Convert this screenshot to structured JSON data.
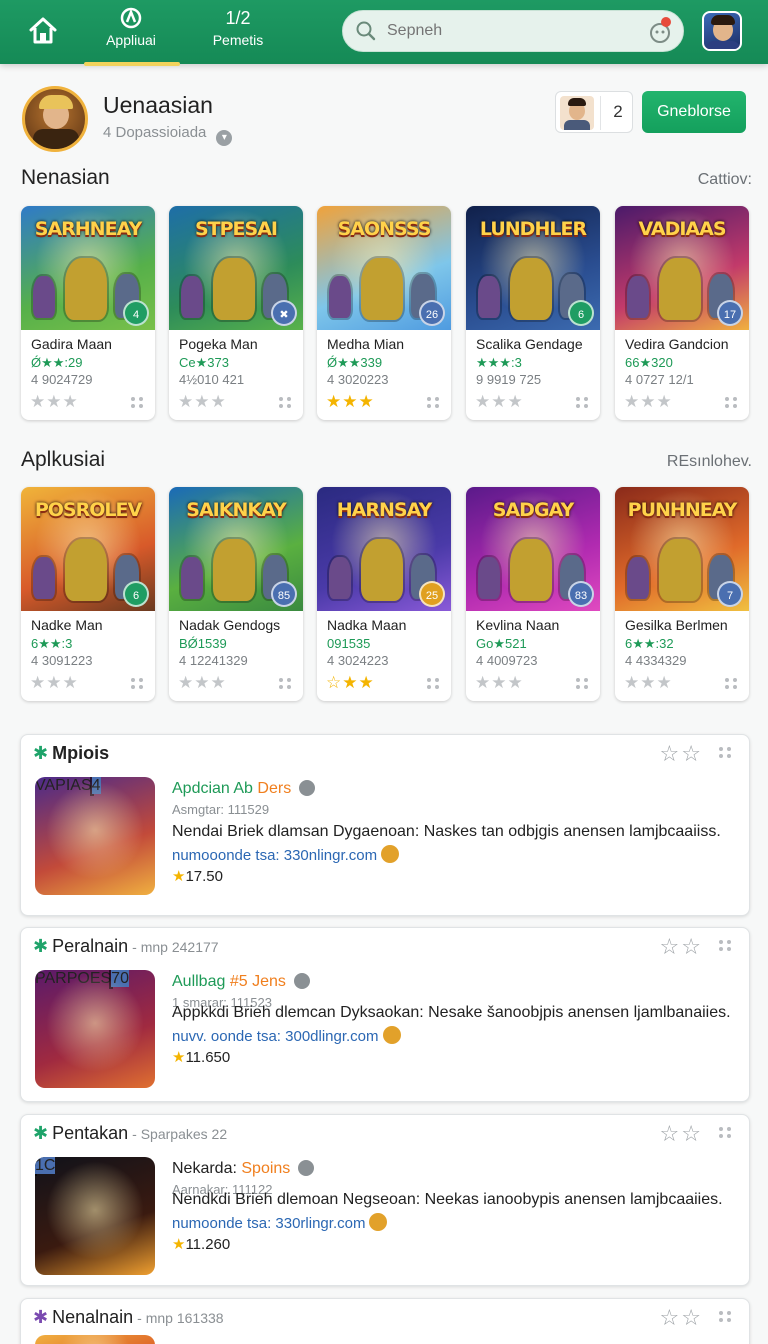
{
  "nav": {
    "tabs": [
      {
        "icon": "app-store-icon",
        "label": "Appliuai"
      },
      {
        "icon_text": "1/2",
        "label": "Pemetis"
      }
    ],
    "search_placeholder": "Sepneh"
  },
  "profile": {
    "name": "Uenaasian",
    "subtitle": "4 Dopassioiada",
    "follow_count": "2",
    "primary_button": "Gneblorse"
  },
  "sections": [
    {
      "title": "Nenasian",
      "link": "Cattiov:",
      "cards": [
        {
          "art": "SARHNEAY",
          "name": "Gadira Maan",
          "meta1": "Ǿ★★:29",
          "meta2": "4 9024729",
          "stars": "★★★",
          "gold": false,
          "badge": "4"
        },
        {
          "art": "STPESAI",
          "name": "Pogeka Man",
          "meta1": "Ce★373",
          "meta2": "4½010 421",
          "stars": "★★★",
          "gold": false,
          "badge": "✖"
        },
        {
          "art": "SAONSSS",
          "name": "Medha Mian",
          "meta1": "Ǿ★★339",
          "meta2": "4 3020223",
          "stars": "★★★",
          "gold": true,
          "badge": "26"
        },
        {
          "art": "LUNDHLER",
          "name": "Scalika Gendage",
          "meta1": "★★★:3",
          "meta2": "9 9919 725",
          "stars": "★★★",
          "gold": false,
          "badge": "6"
        },
        {
          "art": "VADIAAS",
          "name": "Vedira Gandcion",
          "meta1": "66★320",
          "meta2": "4 0727 12/1",
          "stars": "★★★",
          "gold": false,
          "badge": "17"
        }
      ]
    },
    {
      "title": "Aplkusiai",
      "link": "REsınlohev.",
      "cards": [
        {
          "art": "POSROLEV",
          "name": "Nadke Man",
          "meta1": "6★★:3",
          "meta2": "4 3091223",
          "stars": "★★★",
          "gold": false,
          "badge": "6"
        },
        {
          "art": "SAIKNKAY",
          "name": "Nadak Gendogs",
          "meta1": "BǾ1539",
          "meta2": "4 12241329",
          "stars": "★★★",
          "gold": false,
          "badge": "85"
        },
        {
          "art": "HARNSAY",
          "name": "Nadka Maan",
          "meta1": "091535",
          "meta2": "4 3024223",
          "stars": "☆★★",
          "gold": true,
          "badge": "25"
        },
        {
          "art": "SADGAY",
          "name": "Kevlina Naan",
          "meta1": "Go★521",
          "meta2": "4 4009723",
          "stars": "★★★",
          "gold": false,
          "badge": "83"
        },
        {
          "art": "PUNHNEAY",
          "name": "Gesilka Berlmen",
          "meta1": "6★★:32",
          "meta2": "4 4334329",
          "stars": "★★★",
          "gold": false,
          "badge": "7"
        }
      ]
    }
  ],
  "features": [
    {
      "head": "Mpiois",
      "head_sub": "",
      "art": "VAPIAS",
      "title": "Apdcian Ab",
      "title_accent": "Ders",
      "sub": "Asmgtar: 111529",
      "desc": "Nendai Briek dlamsan Dygaenoan: Naskes tan odbjgis anensen lamjbcaaiiss.",
      "link": "numooonde tsa: 330nlingr.com",
      "rating": "17.50",
      "badge": "4"
    },
    {
      "head": "Peralnain",
      "head_sub": "- mnp 242177",
      "art": "PARPOES",
      "title": "Aullbag",
      "title_accent": "#5 Jens",
      "sub": "1 smarar: 111523",
      "desc": "Appkkdi Brieh dlemcan Dyksaokan: Nesake šanoobjpis anensen ljamlbanaiies.",
      "link": "nuvv. oonde tsa: 300dlingr.com",
      "rating": "11.650",
      "badge": "70"
    },
    {
      "head": "Pentakan",
      "head_sub": "- Sparpakes 22",
      "art": "",
      "title": "Nekarda:",
      "title_accent": "Spoins",
      "sub": "Aarnakar: 111122",
      "desc": "Nendkdi Brieh dlemoan Negseoan: Neekas ianoobypis anensen lamjbcaaiies.",
      "link": "numoonde tsa: 330rlingr.com",
      "rating": "11.260",
      "badge": "1C"
    },
    {
      "head": "Nenalnain",
      "head_sub": "- mnp 161338",
      "art": "",
      "title": "",
      "title_accent": "",
      "sub": "",
      "desc": "",
      "link": "",
      "rating": "",
      "badge": ""
    }
  ]
}
